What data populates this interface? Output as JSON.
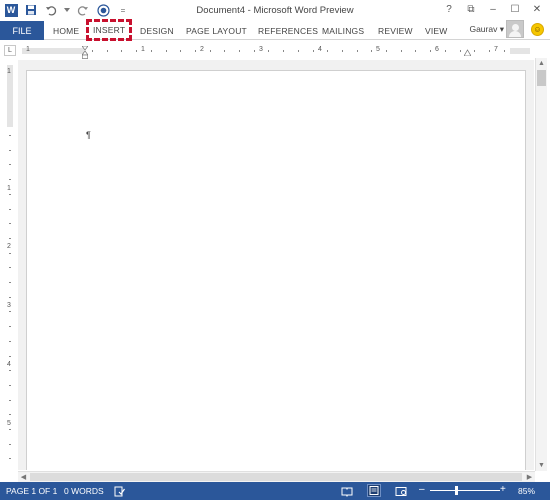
{
  "window": {
    "title": "Document4 - Microsoft Word Preview",
    "help": "?",
    "restore": "⧉",
    "minimize": "–",
    "maximize": "☐",
    "close": "✕"
  },
  "qat": {
    "app_logo": "W",
    "customize": "="
  },
  "ribbon": {
    "tabs": [
      "FILE",
      "HOME",
      "INSERT",
      "DESIGN",
      "PAGE LAYOUT",
      "REFERENCES",
      "MAILINGS",
      "REVIEW",
      "VIEW"
    ],
    "user": "Gaurav",
    "user_caret": "▾"
  },
  "ruler": {
    "corner": "L",
    "h_numbers": [
      "1",
      "1",
      "2",
      "3",
      "4",
      "5",
      "6",
      "7"
    ],
    "v_numbers": [
      "1",
      "1",
      "2",
      "3",
      "4",
      "5"
    ]
  },
  "document": {
    "pilcrow": "¶"
  },
  "status": {
    "page": "PAGE 1 OF 1",
    "words": "0 WORDS",
    "zoom_minus": "–",
    "zoom_plus": "+",
    "zoom": "85%"
  },
  "colors": {
    "accent": "#2b579a",
    "highlight_outline": "#c8102e"
  }
}
